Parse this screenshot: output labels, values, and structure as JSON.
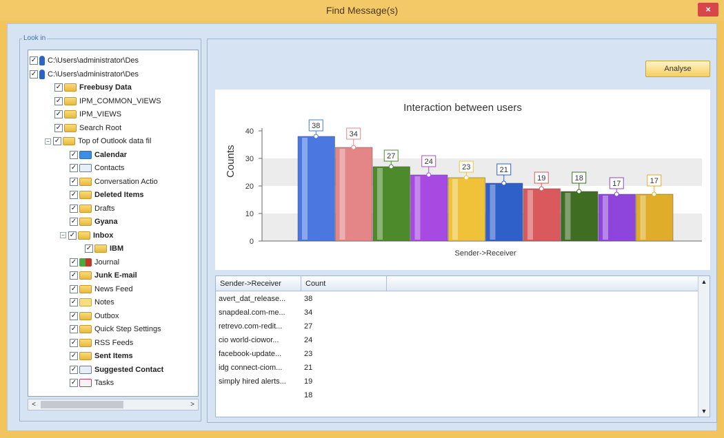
{
  "window": {
    "title": "Find Message(s)",
    "close_label": "×"
  },
  "lookin": {
    "label": "Look in",
    "items": [
      {
        "label": "C:\\Users\\administrator\\Des",
        "depth": 0,
        "exp": "+",
        "icon": "pin-icon",
        "bold": false
      },
      {
        "label": "C:\\Users\\administrator\\Des",
        "depth": 0,
        "exp": "−",
        "icon": "pin-icon",
        "bold": false
      },
      {
        "label": "Freebusy Data",
        "depth": 1,
        "exp": "",
        "icon": "folder-icon",
        "bold": true
      },
      {
        "label": "IPM_COMMON_VIEWS",
        "depth": 1,
        "exp": "",
        "icon": "folder-icon",
        "bold": false
      },
      {
        "label": "IPM_VIEWS",
        "depth": 1,
        "exp": "",
        "icon": "folder-icon",
        "bold": false
      },
      {
        "label": "Search Root",
        "depth": 1,
        "exp": "",
        "icon": "folder-icon",
        "bold": false
      },
      {
        "label": "Top of Outlook data fil",
        "depth": 1,
        "exp": "−",
        "icon": "folder-icon",
        "bold": false
      },
      {
        "label": "Calendar",
        "depth": 2,
        "exp": "",
        "icon": "calendar-icon",
        "bold": true
      },
      {
        "label": "Contacts",
        "depth": 2,
        "exp": "",
        "icon": "contacts-icon",
        "bold": false
      },
      {
        "label": "Conversation Actio",
        "depth": 2,
        "exp": "",
        "icon": "folder-icon",
        "bold": false
      },
      {
        "label": "Deleted Items",
        "depth": 2,
        "exp": "",
        "icon": "folder-icon",
        "bold": true
      },
      {
        "label": "Drafts",
        "depth": 2,
        "exp": "",
        "icon": "folder-icon",
        "bold": false
      },
      {
        "label": "Gyana",
        "depth": 2,
        "exp": "",
        "icon": "folder-icon",
        "bold": true
      },
      {
        "label": "Inbox",
        "depth": 2,
        "exp": "−",
        "icon": "folder-icon",
        "bold": true
      },
      {
        "label": "IBM",
        "depth": 3,
        "exp": "",
        "icon": "folder-icon",
        "bold": true
      },
      {
        "label": "Journal",
        "depth": 2,
        "exp": "",
        "icon": "journal-icon",
        "bold": false
      },
      {
        "label": "Junk E-mail",
        "depth": 2,
        "exp": "",
        "icon": "folder-icon",
        "bold": true
      },
      {
        "label": "News Feed",
        "depth": 2,
        "exp": "",
        "icon": "folder-icon",
        "bold": false
      },
      {
        "label": "Notes",
        "depth": 2,
        "exp": "",
        "icon": "notes-icon",
        "bold": false
      },
      {
        "label": "Outbox",
        "depth": 2,
        "exp": "",
        "icon": "folder-icon",
        "bold": false
      },
      {
        "label": "Quick Step Settings",
        "depth": 2,
        "exp": "",
        "icon": "folder-icon",
        "bold": false
      },
      {
        "label": "RSS Feeds",
        "depth": 2,
        "exp": "",
        "icon": "folder-icon",
        "bold": false
      },
      {
        "label": "Sent Items",
        "depth": 2,
        "exp": "",
        "icon": "folder-icon",
        "bold": true
      },
      {
        "label": "Suggested Contact",
        "depth": 2,
        "exp": "",
        "icon": "contacts-icon",
        "bold": true
      },
      {
        "label": "Tasks",
        "depth": 2,
        "exp": "",
        "icon": "tasks-icon",
        "bold": false
      }
    ]
  },
  "analyse_label": "Analyse",
  "chart_data": {
    "type": "bar",
    "title": "Interaction between users",
    "xlabel": "Sender->Receiver",
    "ylabel": "Counts",
    "ylim": [
      0,
      40
    ],
    "yticks": [
      0,
      10,
      20,
      30,
      40
    ],
    "grid": true,
    "values": [
      38,
      34,
      27,
      24,
      23,
      21,
      19,
      18,
      17,
      17
    ],
    "colors": [
      "#4a78e0",
      "#e48688",
      "#4d8a2c",
      "#a64ae2",
      "#f0c23a",
      "#2f5fc8",
      "#d9595c",
      "#3f6d22",
      "#8d45dc",
      "#e0ad2a"
    ]
  },
  "table": {
    "columns": [
      "Sender->Receiver",
      "Count"
    ],
    "rows": [
      [
        "avert_dat_release...",
        "38"
      ],
      [
        "snapdeal.com-me...",
        "34"
      ],
      [
        "retrevo.com-redit...",
        "27"
      ],
      [
        "cio world-ciowor...",
        "24"
      ],
      [
        "facebook-update...",
        "23"
      ],
      [
        "idg connect-ciom...",
        "21"
      ],
      [
        "simply hired alerts...",
        "19"
      ],
      [
        "",
        "18"
      ]
    ]
  }
}
